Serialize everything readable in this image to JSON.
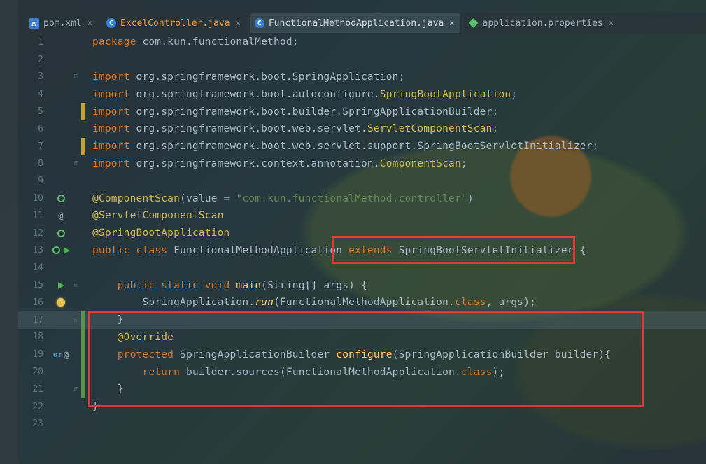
{
  "tabs": [
    {
      "label": "pom.xml",
      "active": false,
      "icon": "m"
    },
    {
      "label": "ExcelController.java",
      "active": false,
      "icon": "c",
      "orange": true
    },
    {
      "label": "FunctionalMethodApplication.java",
      "active": true,
      "icon": "c"
    },
    {
      "label": "application.properties",
      "active": false,
      "icon": "leaf"
    }
  ],
  "code": {
    "l1": {
      "kw": "package",
      "rest": " com.kun.functionalMethod;"
    },
    "l3a": "import",
    "l3b": " org.springframework.boot.SpringApplication;",
    "l4a": "import",
    "l4b": " org.springframework.boot.autoconfigure.",
    "l4c": "SpringBootApplication",
    "l4d": ";",
    "l5a": "import",
    "l5b": " org.springframework.boot.builder.SpringApplicationBuilder;",
    "l6a": "import",
    "l6b": " org.springframework.boot.web.servlet.",
    "l6c": "ServletComponentScan",
    "l6d": ";",
    "l7a": "import",
    "l7b": " org.springframework.boot.web.servlet.support.SpringBootServletInitializer;",
    "l8a": "import",
    "l8b": " org.springframework.context.annotation.",
    "l8c": "ComponentScan",
    "l8d": ";",
    "l10a": "@ComponentScan",
    "l10b": "(",
    "l10c": "value",
    "l10d": " = ",
    "l10e": "\"com.kun.functionalMethod.controller\"",
    "l10f": ")",
    "l11": "@ServletComponentScan",
    "l12": "@SpringBootApplication",
    "l13a": "public class",
    "l13b": " FunctionalMethodApplication ",
    "l13c": "extends",
    "l13d": " SpringBootServletInitializer ",
    "l13e": "{",
    "l15a": "public static void",
    "l15b": " ",
    "l15c": "main",
    "l15d": "(String[] args) ",
    "l15e": "{",
    "l16a": "SpringApplication.",
    "l16b": "run",
    "l16c": "(FunctionalMethodApplication.",
    "l16d": "class",
    "l16e": ", args);",
    "l17": "}",
    "l18": "@Override",
    "l19a": "protected",
    "l19b": " SpringApplicationBuilder ",
    "l19c": "configure",
    "l19d": "(SpringApplicationBuilder builder){",
    "l20a": "return",
    "l20b": " builder.sources(FunctionalMethodApplication.",
    "l20c": "class",
    "l20d": ");",
    "l21": "}",
    "l22": "}"
  },
  "lineNumbers": [
    "1",
    "2",
    "3",
    "4",
    "5",
    "6",
    "7",
    "8",
    "9",
    "10",
    "11",
    "12",
    "13",
    "14",
    "15",
    "16",
    "17",
    "18",
    "19",
    "20",
    "21",
    "22",
    "23"
  ]
}
